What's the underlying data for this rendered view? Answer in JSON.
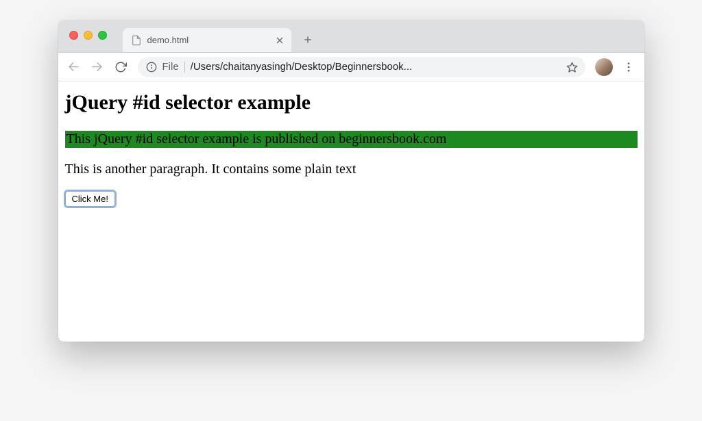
{
  "browser": {
    "tab": {
      "title": "demo.html"
    },
    "address": {
      "scheme_label": "File",
      "path": "/Users/chaitanyasingh/Desktop/Beginnersbook..."
    }
  },
  "page": {
    "heading": "jQuery #id selector example",
    "para_highlighted": "This jQuery #id selector example is published on beginnersbook.com",
    "para_plain": "This is another paragraph. It contains some plain text",
    "button_label": "Click Me!"
  }
}
